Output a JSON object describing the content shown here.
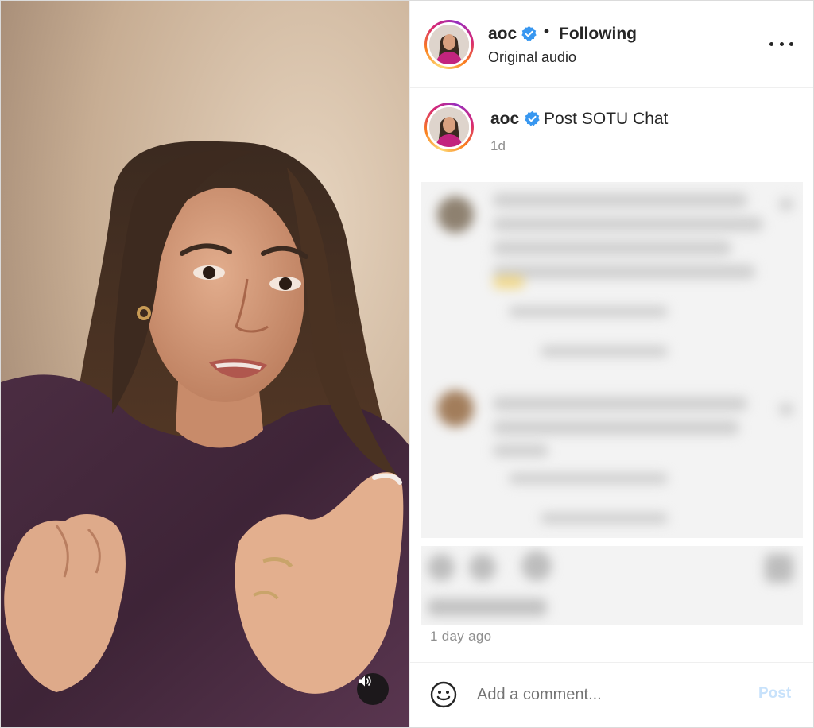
{
  "post": {
    "username": "aoc",
    "verified": true,
    "follow_status": "Following",
    "separator": "•",
    "audio_label": "Original audio",
    "caption": "Post SOTU Chat",
    "caption_time": "1d",
    "date_ago": "1 day ago"
  },
  "comment_box": {
    "placeholder": "Add a comment...",
    "post_label": "Post"
  },
  "icons": {
    "verified": "verified-badge-icon",
    "more": "more-options-icon",
    "sound": "speaker-icon",
    "emoji": "emoji-icon"
  },
  "colors": {
    "accent": "#3897f0",
    "post_disabled": "#c8e2fb",
    "muted_text": "#8e8e8e"
  }
}
